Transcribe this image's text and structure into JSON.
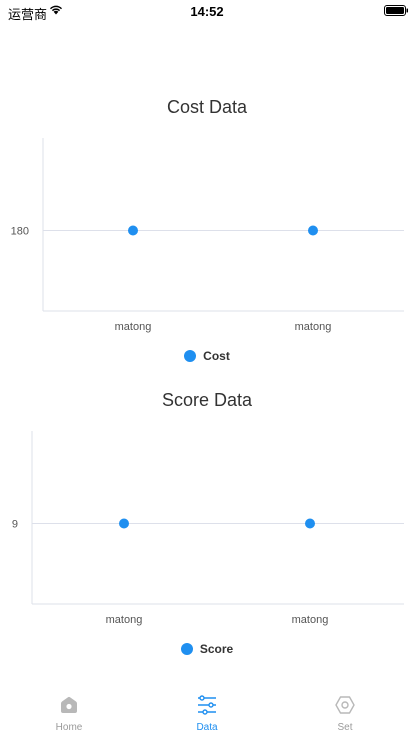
{
  "status_bar": {
    "carrier": "运营商",
    "time": "14:52",
    "wifi_icon": "wifi-icon",
    "battery_icon": "battery-icon"
  },
  "charts": [
    {
      "title": "Cost Data",
      "legend": "Cost",
      "y_tick": "180"
    },
    {
      "title": "Score Data",
      "legend": "Score",
      "y_tick": "9"
    }
  ],
  "chart_data": [
    {
      "type": "scatter",
      "title": "Cost Data",
      "categories": [
        "matong",
        "matong"
      ],
      "series": [
        {
          "name": "Cost",
          "values": [
            180,
            180
          ]
        }
      ],
      "yticks": [
        180
      ],
      "grid": true,
      "legend_position": "bottom",
      "color": "#1f8ff0"
    },
    {
      "type": "scatter",
      "title": "Score Data",
      "categories": [
        "matong",
        "matong"
      ],
      "series": [
        {
          "name": "Score",
          "values": [
            9,
            9
          ]
        }
      ],
      "yticks": [
        9
      ],
      "grid": true,
      "legend_position": "bottom",
      "color": "#1f8ff0"
    }
  ],
  "tab_bar": {
    "tabs": [
      {
        "label": "Home",
        "icon": "home-icon",
        "active": false
      },
      {
        "label": "Data",
        "icon": "sliders-icon",
        "active": true
      },
      {
        "label": "Set",
        "icon": "settings-hexagon-icon",
        "active": false
      }
    ],
    "active_color": "#1f8ff0",
    "inactive_color": "#9a9a9a"
  },
  "colors": {
    "series": "#1f8ff0",
    "axis": "#dde0ea",
    "text": "#333333",
    "tick_text": "#555555"
  }
}
